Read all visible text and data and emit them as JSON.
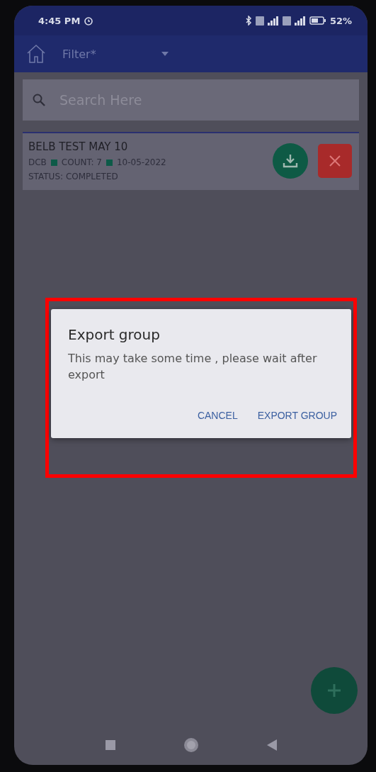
{
  "status_bar": {
    "time": "4:45 PM",
    "battery": "52%"
  },
  "app_bar": {
    "filter": "Filter*"
  },
  "search": {
    "placeholder": "Search Here"
  },
  "groups": [
    {
      "title": "BELB TEST MAY 10",
      "code": "DCB",
      "count": "COUNT: 7",
      "date": "10-05-2022",
      "status": "STATUS: COMPLETED"
    }
  ],
  "dialog": {
    "title": "Export group",
    "message": "This may take some time , please wait after export",
    "buttons": [
      "CANCEL",
      "EXPORT GROUP"
    ]
  }
}
